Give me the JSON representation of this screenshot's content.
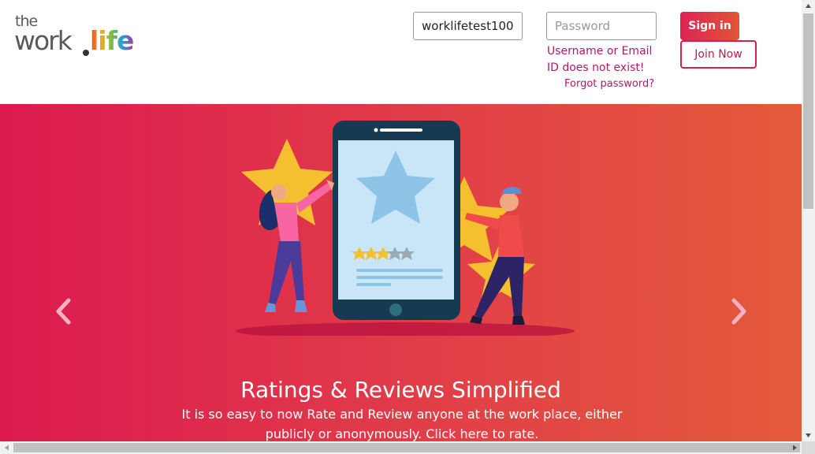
{
  "header": {
    "logo": {
      "the": "the",
      "work": "work",
      "life": "life"
    },
    "login": {
      "username_value": "worklifetest100",
      "password_placeholder": "Password",
      "signin_label": "Sign in",
      "join_label": "Join Now",
      "error_message": "Username or Email ID does not exist!",
      "forgot_label": "Forgot password?"
    }
  },
  "banner": {
    "title": "Ratings & Reviews Simplified",
    "subtitle": "It is so easy to now Rate and Review anyone at the work place, either publicly or anonymously. Click here to rate.",
    "illustration_rating": 3,
    "illustration_rating_max": 5
  },
  "colors": {
    "accent": "#d81e4d",
    "banner_start": "#dc1a50",
    "banner_end": "#e45a3a",
    "link": "#b0196a"
  },
  "icons": {
    "prev": "chevron-left-icon",
    "next": "chevron-right-icon"
  }
}
